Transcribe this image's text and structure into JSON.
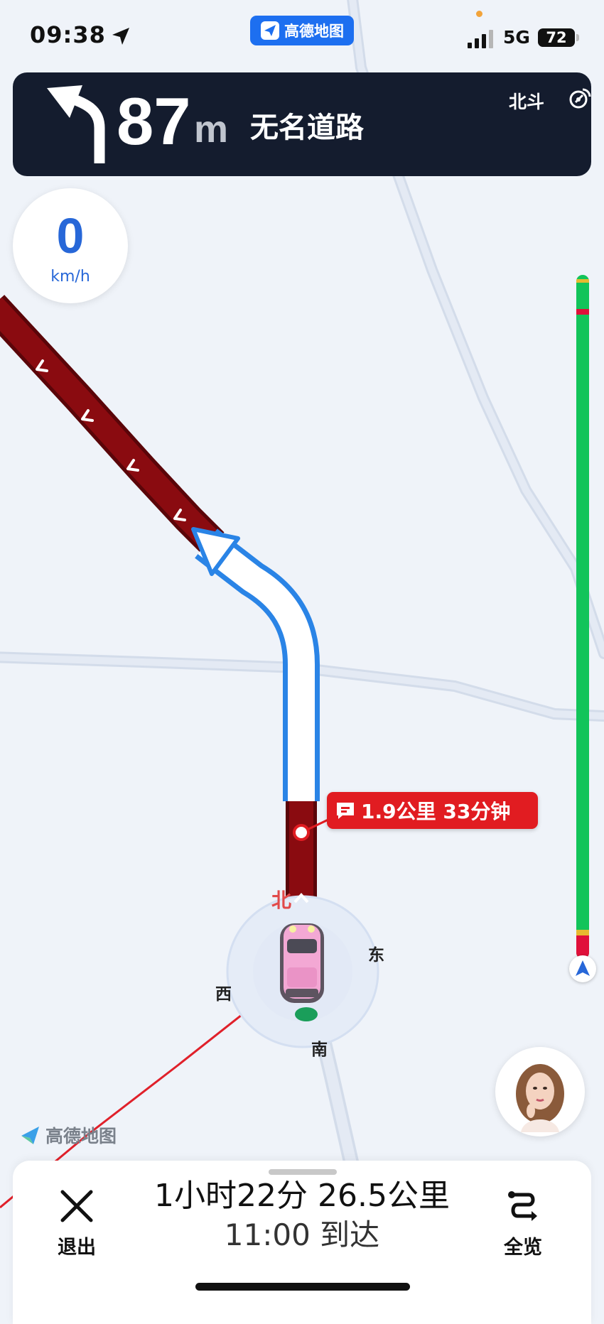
{
  "status_bar": {
    "time": "09:38",
    "app_badge": "高德地图",
    "network": "5G",
    "battery": "72"
  },
  "navigation": {
    "distance_value": "87",
    "distance_unit": "m",
    "road_name": "无名道路",
    "turn_direction": "turn-left-icon",
    "gnss_label": "北斗"
  },
  "speed": {
    "value": "0",
    "unit": "km/h"
  },
  "route_callout": {
    "text": "1.9公里 33分钟"
  },
  "compass": {
    "north": "北",
    "east": "东",
    "south": "南",
    "west": "西"
  },
  "map_watermark": "高德地图",
  "trip": {
    "summary": "1小时22分  26.5公里",
    "arrival": "11:00 到达"
  },
  "buttons": {
    "exit_label": "退出",
    "overview_label": "全览"
  },
  "colors": {
    "route_congested": "#8a0b10",
    "route_arrow": "#2a84e6",
    "traffic_smooth": "#12c45a",
    "traffic_slow": "#e7b930",
    "traffic_jam": "#e0103a",
    "banner": "#141c2e",
    "accent_blue": "#1d6ff0"
  }
}
